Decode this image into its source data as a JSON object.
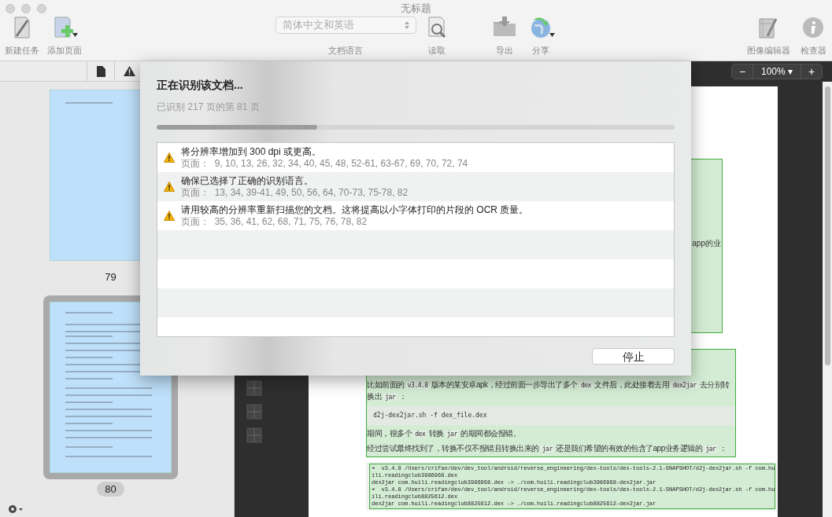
{
  "window": {
    "title": "无标题"
  },
  "toolbar": {
    "left": [
      {
        "label": "新建任务",
        "kind": "button"
      },
      {
        "label": "添加页面",
        "kind": "menu"
      }
    ],
    "language": {
      "value": "简体中文和英语",
      "label": "文档语言"
    },
    "center": [
      {
        "label": "读取",
        "kind": "button"
      },
      {
        "label": "导出",
        "kind": "button"
      },
      {
        "label": "分享",
        "kind": "menu"
      }
    ],
    "right": [
      {
        "label": "图像编辑器",
        "kind": "button"
      },
      {
        "label": "检查器",
        "kind": "button"
      }
    ]
  },
  "sidebar": {
    "thumbnails": [
      {
        "page": "79",
        "selected": false
      },
      {
        "page": "80",
        "selected": true
      }
    ]
  },
  "zoom": {
    "value": "100%",
    "caret": "▾",
    "minus": "−",
    "plus": "+"
  },
  "dialog": {
    "title": "正在识别该文档...",
    "subtitle": "已识别 217 页的第 81 页",
    "progress": {
      "level": 0.31
    },
    "warnings": [
      {
        "message": "将分辨率增加到 300 dpi 或更高。",
        "pages_label": "页面：",
        "pages": "9, 10, 13, 26, 32, 34, 40, 45, 48, 52-61, 63-67, 69, 70, 72, 74"
      },
      {
        "message": "确保已选择了正确的识别语言。",
        "pages_label": "页面：",
        "pages": "13, 34, 39-41, 49, 50, 56, 64, 70-73, 75-78, 82"
      },
      {
        "message": "请用较高的分辨率重新扫描您的文档。这将提高以小字体打印的片段的 OCR 质量。",
        "pages_label": "页面：",
        "pages": "35, 36, 41, 62, 68, 71, 75, 76, 78, 82"
      }
    ],
    "stop_button": "停止"
  },
  "document": {
    "fragment": "app的业",
    "paragraphs": [
      [
        {
          "text": "比如前面的 "
        },
        {
          "text": "v3.4.8",
          "code": true
        },
        {
          "text": " 版本的某安卓apk，经过前面一步导出了多个 "
        },
        {
          "text": "dex",
          "code": true
        },
        {
          "text": " 文件后，此处接着去用 "
        },
        {
          "text": "dex2jar",
          "code": true
        },
        {
          "text": " 去分别转换出 "
        },
        {
          "text": "jar",
          "code": true
        },
        {
          "text": " ："
        }
      ],
      [
        {
          "text": "期间，很多个 "
        },
        {
          "text": "dex",
          "code": true
        },
        {
          "text": " 转换 "
        },
        {
          "text": "jar",
          "code": true
        },
        {
          "text": " 的期间都会报错。"
        }
      ],
      [
        {
          "text": "经过尝试最终找到了，转换不仅不报错且转换出来的 "
        },
        {
          "text": "jar",
          "code": true
        },
        {
          "text": " 还是我们希望的有效的包含了app业务逻辑的 "
        },
        {
          "text": "jar",
          "code": true
        },
        {
          "text": " ："
        }
      ]
    ],
    "command": "d2j-dex2jar.sh -f dex_file.dex",
    "output_lines": [
      "➜  v3.4.8 /Users/crifan/dev/dev_tool/android/reverse_engineering/dex-tools/dex-tools-2.1-SNAPSHOT/d2j-dex2jar.sh -f com.hu",
      "ili.readingclub3986968.dex",
      "dex2jar com.huili.readingclub3986968.dex -> ./com.huili.readingclub3986968-dex2jar.jar",
      "➜  v3.4.8 /Users/crifan/dev/dev_tool/android/reverse_engineering/dex-tools/dex-tools-2.1-SNAPSHOT/d2j-dex2jar.sh -f com.hu",
      "ili.readingclub8825612.dex",
      "dex2jar com.huili.readingclub8825612.dex -> ./com.huili.readingclub8825612-dex2jar.jar"
    ]
  }
}
